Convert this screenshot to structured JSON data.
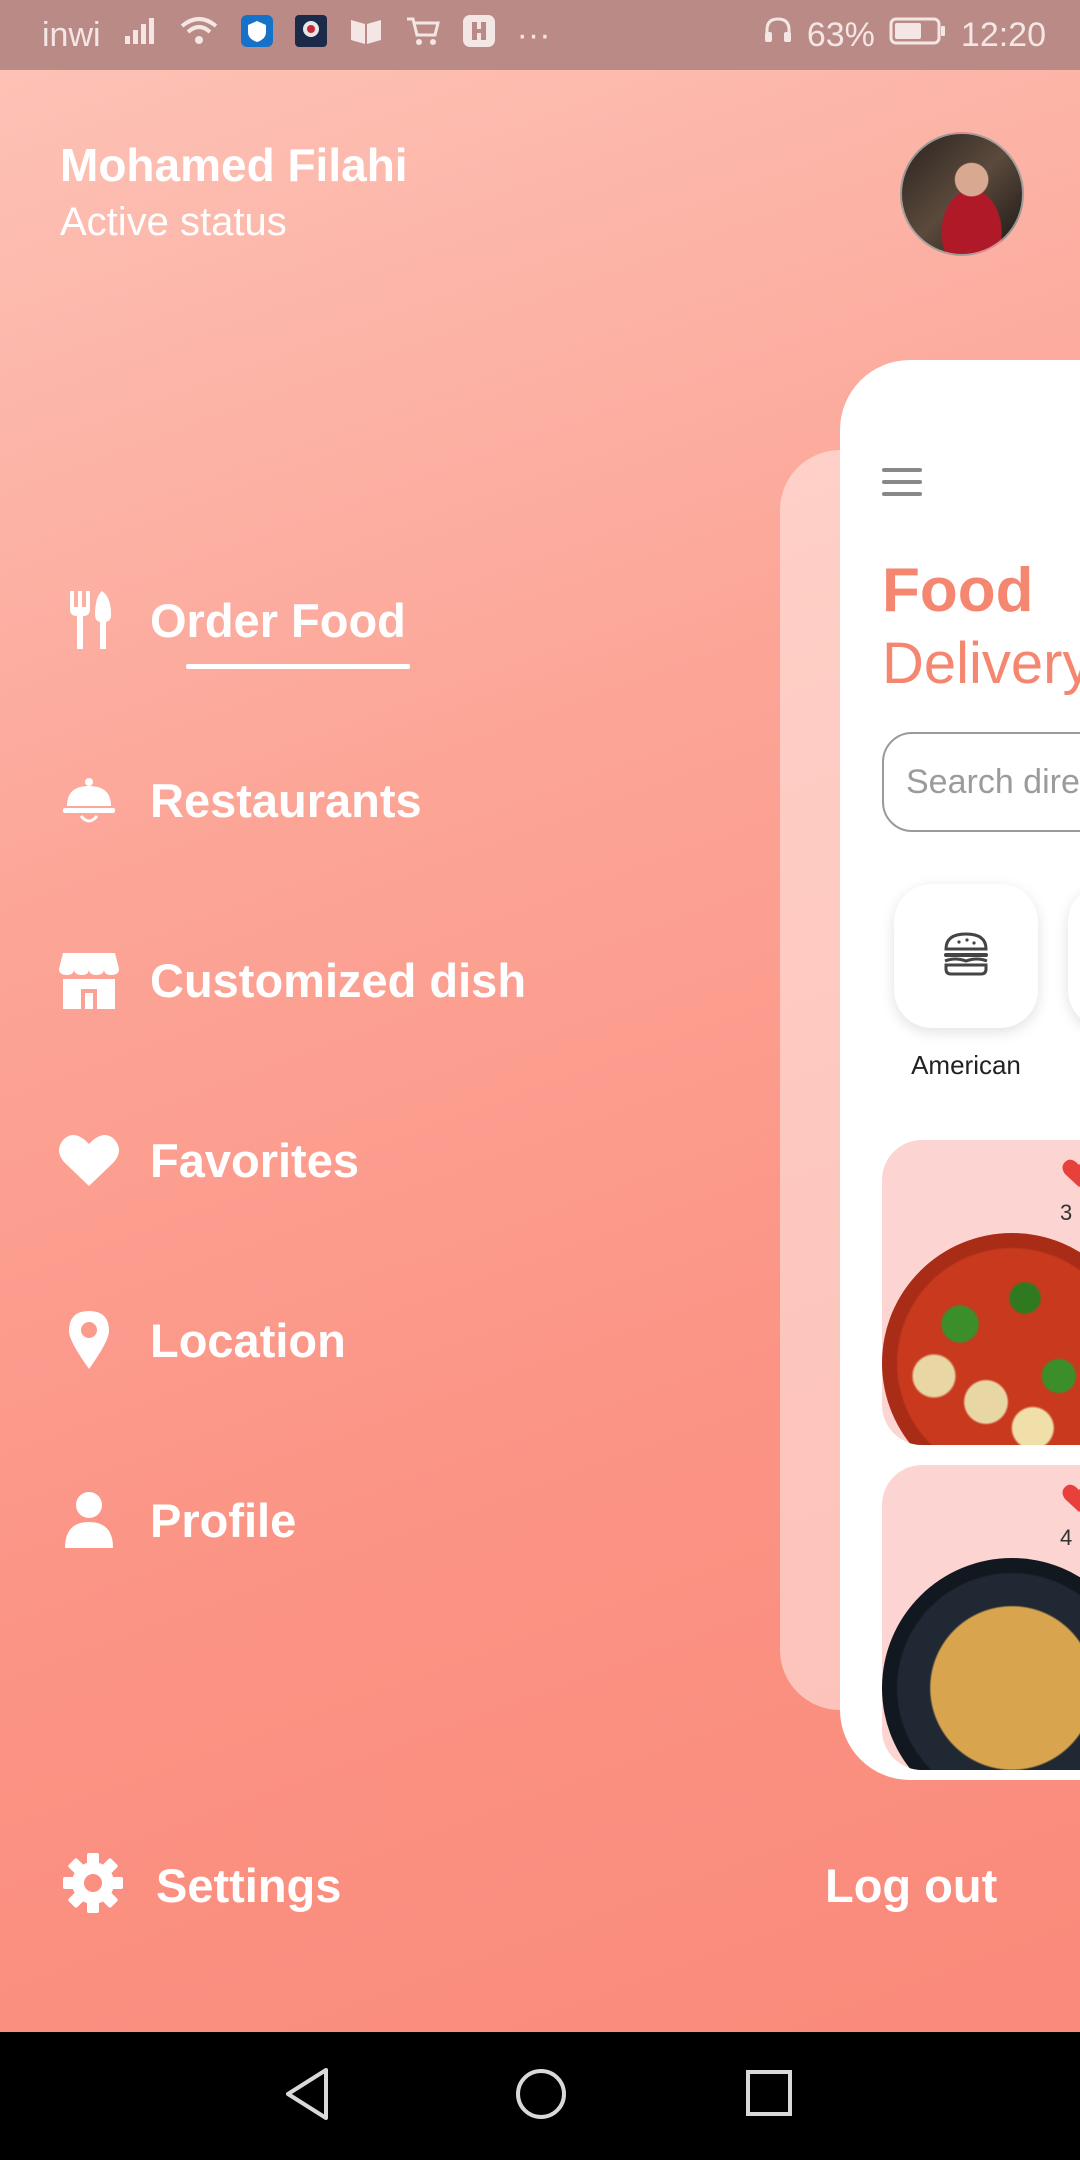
{
  "status_bar": {
    "carrier": "inwi",
    "more": "···",
    "battery_percent": "63%",
    "time": "12:20"
  },
  "user": {
    "name": "Mohamed Filahi",
    "status": "Active status"
  },
  "menu": {
    "items": [
      {
        "label": "Order Food",
        "icon": "utensils-icon",
        "selected": true
      },
      {
        "label": "Restaurants",
        "icon": "cloche-icon"
      },
      {
        "label": "Customized dish",
        "icon": "store-icon"
      },
      {
        "label": "Favorites",
        "icon": "heart-icon"
      },
      {
        "label": "Location",
        "icon": "map-pin-icon"
      },
      {
        "label": "Profile",
        "icon": "user-icon"
      }
    ],
    "settings_label": "Settings",
    "logout_label": "Log out"
  },
  "preview": {
    "title_line1": "Food",
    "title_line2": "Delivery",
    "search_placeholder": "Search directly",
    "category_label": "American",
    "food_cards": [
      {
        "likes": "3"
      },
      {
        "likes": "4"
      }
    ]
  },
  "colors": {
    "gradient_top": "#fdc4b8",
    "gradient_bottom": "#fa8a7b",
    "accent": "#f5866f",
    "heart": "#e8413c"
  }
}
